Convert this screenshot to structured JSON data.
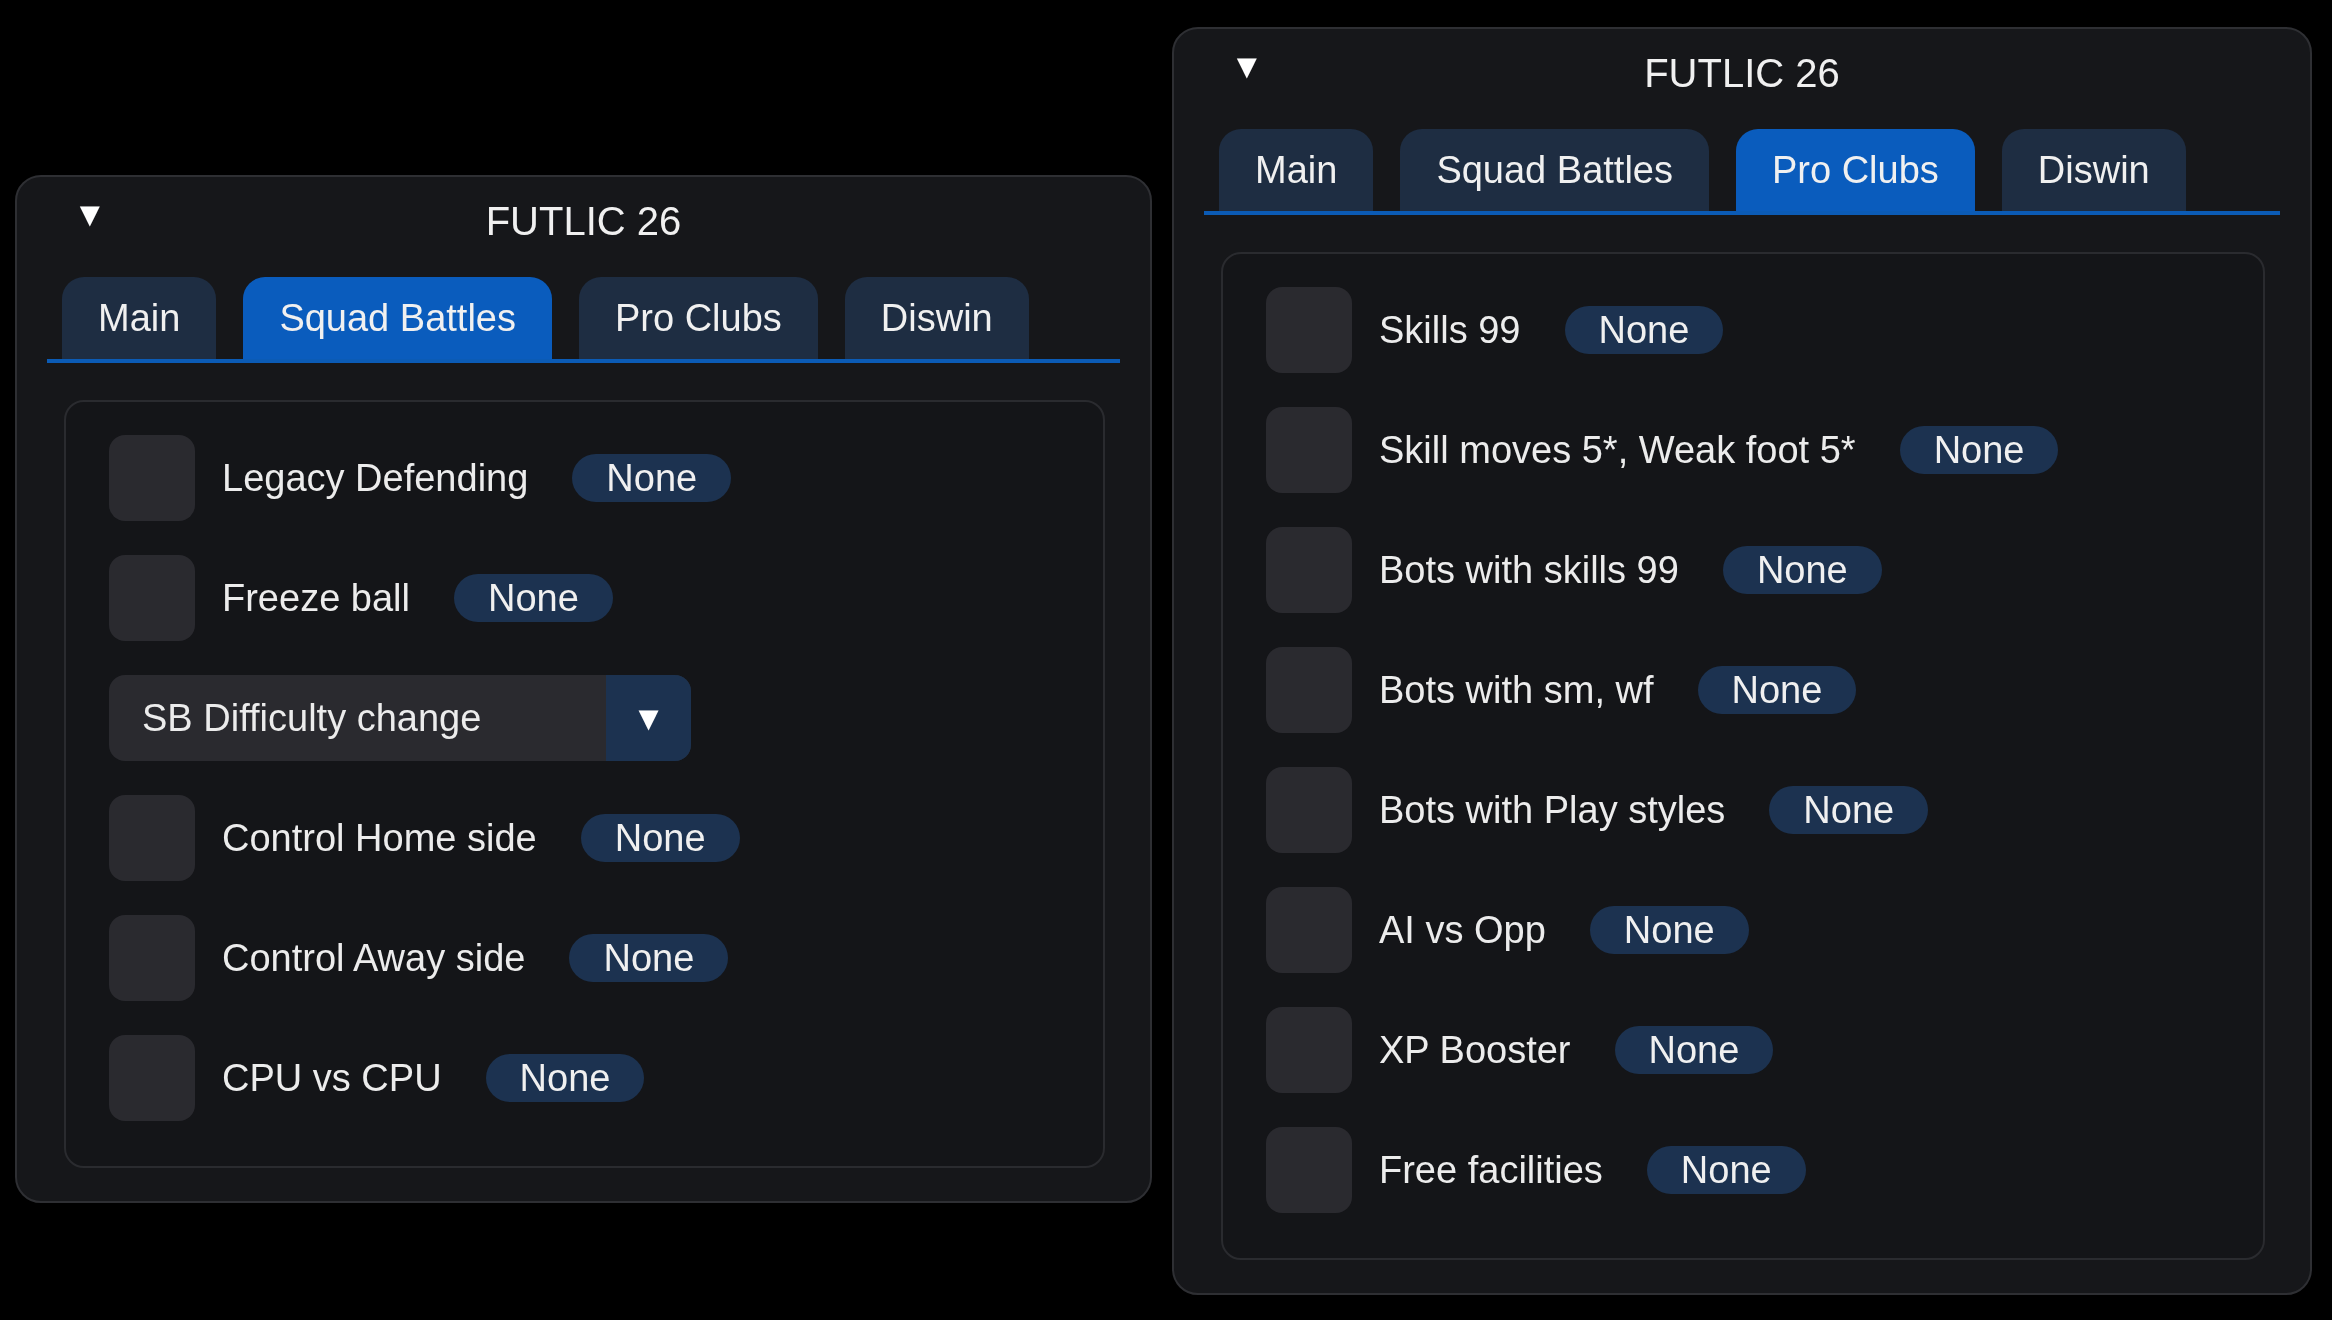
{
  "windows": [
    {
      "title": "FUTLIC 26",
      "collapse_arrow": "▼",
      "tabs": [
        {
          "label": "Main",
          "selected": false
        },
        {
          "label": "Squad Battles",
          "selected": true
        },
        {
          "label": "Pro Clubs",
          "selected": false
        },
        {
          "label": "Diswin",
          "selected": false
        }
      ],
      "items": [
        {
          "kind": "checkbox",
          "label": "Legacy Defending",
          "checked": false,
          "key": "None"
        },
        {
          "kind": "checkbox",
          "label": "Freeze ball",
          "checked": false,
          "key": "None"
        },
        {
          "kind": "combo",
          "label": "SB Difficulty change",
          "arrow": "▼"
        },
        {
          "kind": "checkbox",
          "label": "Control Home side",
          "checked": false,
          "key": "None"
        },
        {
          "kind": "checkbox",
          "label": "Control Away side",
          "checked": false,
          "key": "None"
        },
        {
          "kind": "checkbox",
          "label": "CPU vs CPU",
          "checked": false,
          "key": "None"
        }
      ]
    },
    {
      "title": "FUTLIC 26",
      "collapse_arrow": "▼",
      "tabs": [
        {
          "label": "Main",
          "selected": false
        },
        {
          "label": "Squad Battles",
          "selected": false
        },
        {
          "label": "Pro Clubs",
          "selected": true
        },
        {
          "label": "Diswin",
          "selected": false
        }
      ],
      "items": [
        {
          "kind": "checkbox",
          "label": "Skills 99",
          "checked": false,
          "key": "None"
        },
        {
          "kind": "checkbox",
          "label": "Skill moves 5*, Weak foot 5*",
          "checked": false,
          "key": "None"
        },
        {
          "kind": "checkbox",
          "label": "Bots with skills 99",
          "checked": false,
          "key": "None"
        },
        {
          "kind": "checkbox",
          "label": "Bots with sm, wf",
          "checked": false,
          "key": "None"
        },
        {
          "kind": "checkbox",
          "label": "Bots with Play styles",
          "checked": false,
          "key": "None"
        },
        {
          "kind": "checkbox",
          "label": "AI vs Opp",
          "checked": false,
          "key": "None"
        },
        {
          "kind": "checkbox",
          "label": "XP Booster",
          "checked": false,
          "key": "None"
        },
        {
          "kind": "checkbox",
          "label": "Free facilities",
          "checked": false,
          "key": "None"
        }
      ]
    }
  ]
}
